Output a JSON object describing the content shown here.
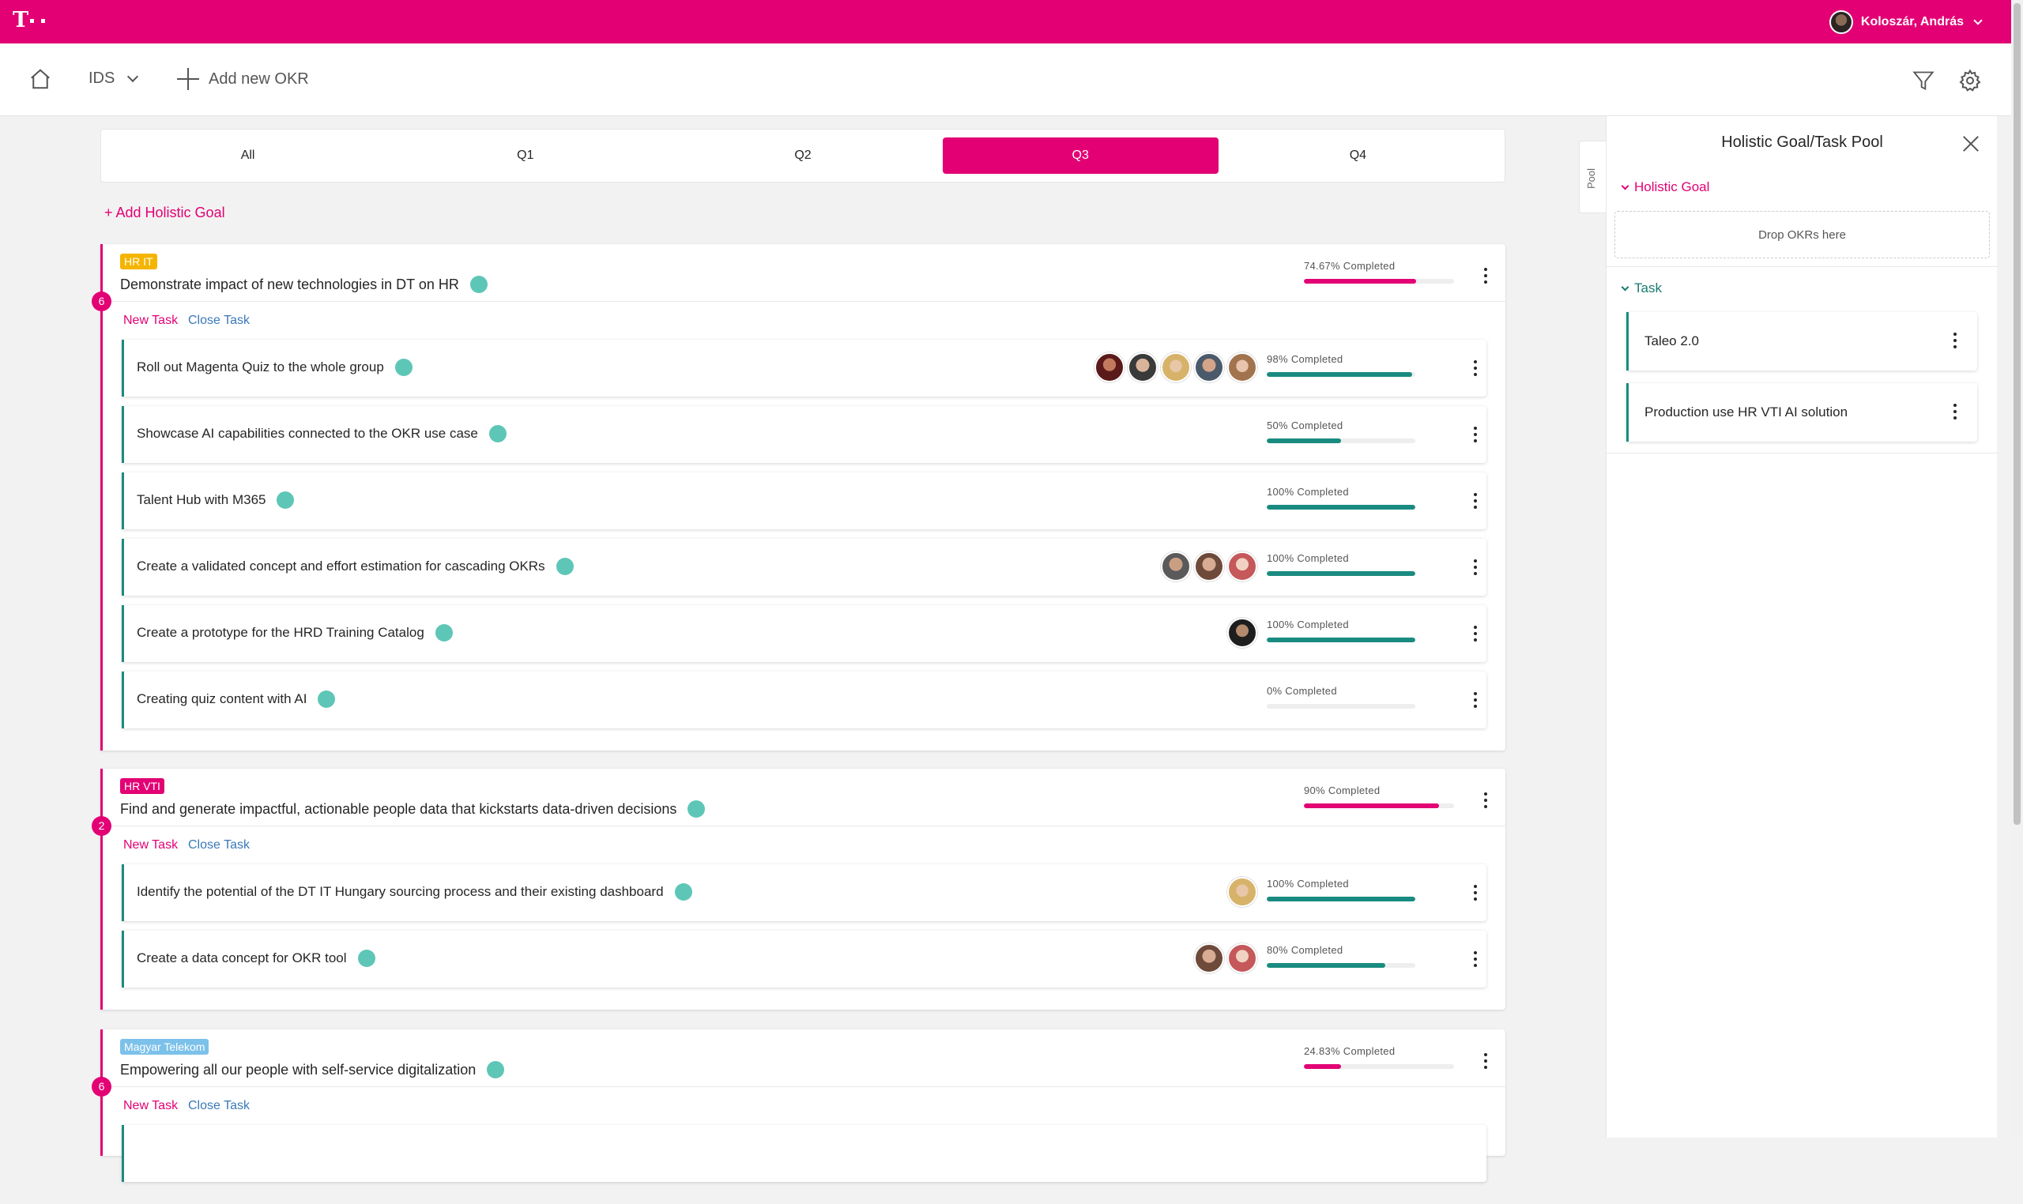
{
  "header": {
    "user_name": "Koloszár, András"
  },
  "toolbar": {
    "org_select": "IDS",
    "add_okr_label": "Add new OKR"
  },
  "tabs": [
    {
      "label": "All",
      "active": false
    },
    {
      "label": "Q1",
      "active": false
    },
    {
      "label": "Q2",
      "active": false
    },
    {
      "label": "Q3",
      "active": true
    },
    {
      "label": "Q4",
      "active": false
    }
  ],
  "add_goal_label": "+ Add Holistic Goal",
  "task_actions": {
    "new": "New Task",
    "close": "Close Task"
  },
  "goals": [
    {
      "badge": "HR IT",
      "badge_color": "#f5b400",
      "title": "Demonstrate impact of new technologies in DT on HR",
      "progress_label": "74.67% Completed",
      "progress": 74.67,
      "count": "6",
      "tasks": [
        {
          "title": "Roll out Magenta Quiz to the whole group",
          "progress_label": "98% Completed",
          "progress": 98
        },
        {
          "title": "Showcase AI capabilities connected to the OKR use case",
          "progress_label": "50% Completed",
          "progress": 50
        },
        {
          "title": "Talent Hub with M365",
          "progress_label": "100% Completed",
          "progress": 100
        },
        {
          "title": "Create a validated concept and effort estimation for cascading OKRs",
          "progress_label": "100% Completed",
          "progress": 100
        },
        {
          "title": "Create a prototype for the HRD Training Catalog",
          "progress_label": "100% Completed",
          "progress": 100
        },
        {
          "title": "Creating quiz content with AI",
          "progress_label": "0% Completed",
          "progress": 0
        }
      ]
    },
    {
      "badge": "HR VTI",
      "badge_color": "#e20074",
      "title": "Find and generate impactful, actionable people data that kickstarts data-driven decisions",
      "progress_label": "90% Completed",
      "progress": 90,
      "count": "2",
      "tasks": [
        {
          "title": "Identify the potential of the DT IT Hungary sourcing process and their existing dashboard",
          "progress_label": "100% Completed",
          "progress": 100
        },
        {
          "title": "Create a data concept for OKR tool",
          "progress_label": "80% Completed",
          "progress": 80
        }
      ]
    },
    {
      "badge": "Magyar Telekom",
      "badge_color": "#7cc1ea",
      "title": "Empowering all our people with self-service digitalization",
      "progress_label": "24.83% Completed",
      "progress": 24.83,
      "count": "6",
      "tasks": []
    }
  ],
  "pool": {
    "tab_label": "Pool",
    "title": "Holistic Goal/Task Pool",
    "holistic_goal_header": "Holistic Goal",
    "drop_label": "Drop OKRs here",
    "task_header": "Task",
    "tasks": [
      "Taleo 2.0",
      "Production use HR VTI AI solution"
    ]
  },
  "colors": {
    "brand": "#e20074",
    "goal_bar": "#e20074",
    "task_bar": "#1a8b80",
    "status_dot": "#5ec6b7",
    "link": "#3a79b8"
  },
  "icons": [
    "telekom-logo-icon",
    "home-icon",
    "chevron-down-icon",
    "plus-icon",
    "filter-icon",
    "gear-icon",
    "more-vert-icon",
    "close-icon",
    "status-dot-icon"
  ]
}
